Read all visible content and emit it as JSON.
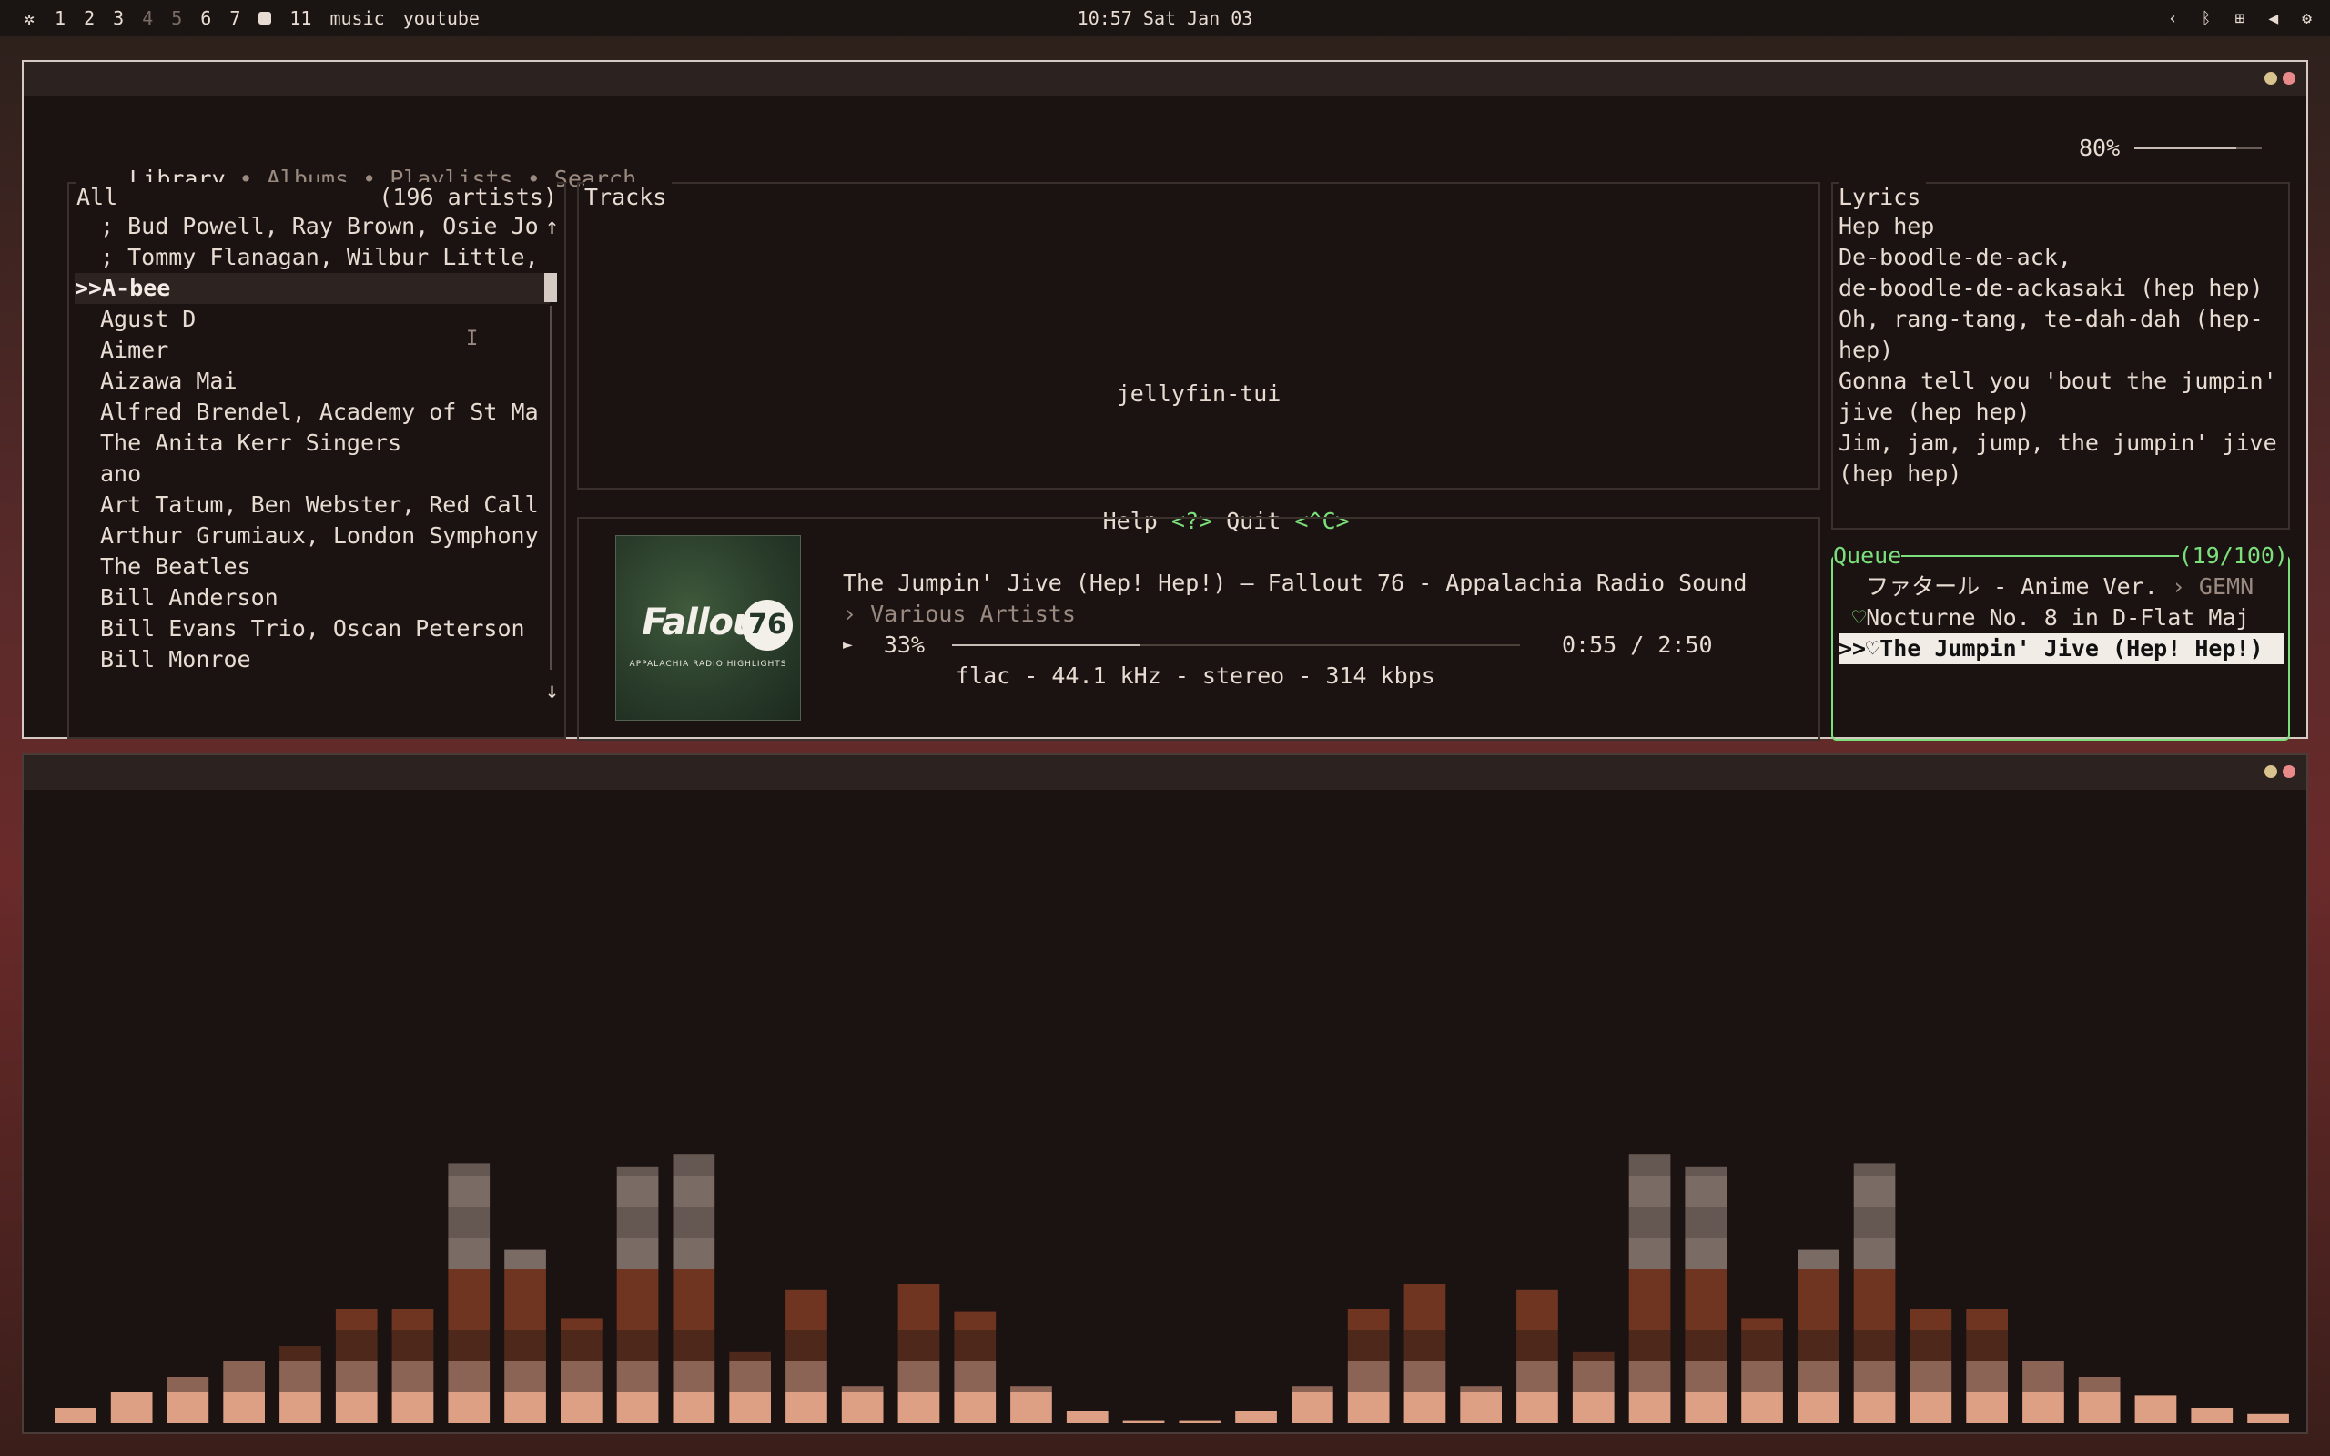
{
  "topbar": {
    "workspaces": [
      {
        "label": "1",
        "dim": false
      },
      {
        "label": "2",
        "dim": false
      },
      {
        "label": "3",
        "dim": false
      },
      {
        "label": "4",
        "dim": true
      },
      {
        "label": "5",
        "dim": true
      },
      {
        "label": "6",
        "dim": false
      },
      {
        "label": "7",
        "dim": false
      },
      {
        "label": "11",
        "dim": false
      },
      {
        "label": "music",
        "dim": false
      },
      {
        "label": "youtube",
        "dim": false
      }
    ],
    "clock": "10:57 Sat Jan 03",
    "tray_icons": [
      "chevron-left-icon",
      "bluetooth-icon",
      "network-icon",
      "volume-icon",
      "settings-icon"
    ]
  },
  "tabs": {
    "items": [
      "Library",
      "Albums",
      "Playlists",
      "Search"
    ],
    "separator": " • ",
    "active": "Library"
  },
  "volume": {
    "label": "80%",
    "level": 0.8
  },
  "artists": {
    "title": "All",
    "count": "(196 artists)",
    "scroll_up": "↑",
    "scroll_down": "↓",
    "items": [
      "; Bud Powell, Ray Brown, Osie Jo",
      "; Tommy Flanagan, Wilbur Little,",
      "A-bee",
      "Agust D",
      "Aimer",
      "Aizawa Mai",
      "Alfred Brendel, Academy of St Ma",
      "The Anita Kerr Singers",
      "ano",
      "Art Tatum, Ben Webster, Red Call",
      "Arthur Grumiaux, London Symphony",
      "The Beatles",
      "Bill Anderson",
      "Bill Evans Trio, Oscan Peterson",
      "Bill Monroe"
    ],
    "selected_index": 2,
    "selected_marker": ">>"
  },
  "tracks": {
    "title": "Tracks",
    "app_name": "jellyfin-tui",
    "help_label": "Help",
    "help_key": "<?>",
    "quit_label": "Quit",
    "quit_key": "<^C>"
  },
  "now_playing": {
    "title": "The Jumpin' Jive (Hep! Hep!) — Fallout 76 - Appalachia Radio Sound",
    "artist": "› Various Artists",
    "play_symbol": "►",
    "percent": "33%",
    "progress": 0.33,
    "time": "0:55 / 2:50",
    "format": "flac - 44.1 kHz - stereo - 314 kbps",
    "cover": {
      "title": "Fallout",
      "badge": "76",
      "subtitle": "APPALACHIA RADIO HIGHLIGHTS",
      "bg": "#2e4430"
    }
  },
  "lyrics": {
    "title": "Lyrics",
    "lines": [
      "Hep hep",
      "De-boodle-de-ack,",
      "de-boodle-de-ackasaki (hep hep)",
      "Oh, rang-tang, te-dah-dah (hep-hep)",
      "Gonna tell you 'bout the jumpin' jive (hep hep)",
      "Jim, jam, jump, the jumpin' jive (hep hep)"
    ]
  },
  "queue": {
    "title": "Queue",
    "count": "(19/100)",
    "items": [
      {
        "prefix": "  ",
        "text": "ファタール - Anime Ver.",
        "suffix": " › GEMN",
        "current": false
      },
      {
        "prefix": " ♡",
        "text": "Nocturne No. 8 in D-Flat Maj",
        "suffix": "",
        "current": false
      },
      {
        "prefix": ">>♡",
        "text": "The Jumpin' Jive (Hep! Hep!)",
        "suffix": "",
        "current": true
      }
    ]
  },
  "visualizer": {
    "levels": [
      0.5,
      1,
      1.5,
      2,
      2.5,
      3.7,
      3.7,
      8.4,
      5.6,
      3.4,
      8.3,
      8.7,
      2.3,
      4.3,
      1.2,
      4.5,
      3.6,
      1.2,
      0.4,
      0.1,
      0.1,
      0.4,
      1.2,
      3.7,
      4.5,
      1.2,
      4.3,
      2.3,
      8.7,
      8.3,
      3.4,
      5.6,
      8.4,
      3.7,
      3.7,
      2,
      1.5,
      0.9,
      0.5,
      0.3
    ],
    "colors": {
      "base": "#e8a88c",
      "mid": "#7a3a24",
      "top": "#f0d8cc"
    }
  },
  "colors": {
    "accent_green": "#7be07b",
    "background": "#1b1312"
  }
}
